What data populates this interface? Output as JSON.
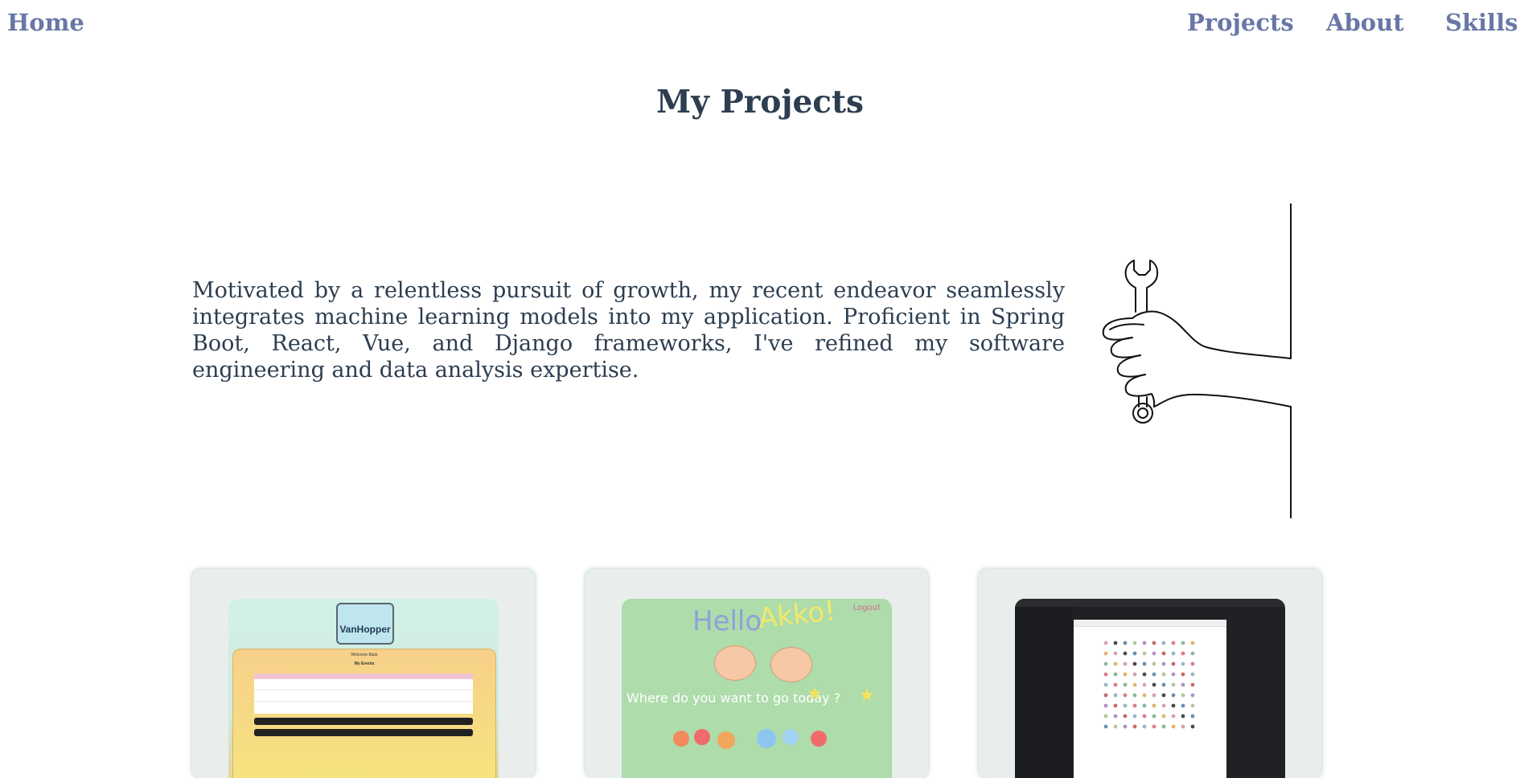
{
  "nav": {
    "home": "Home",
    "projects": "Projects",
    "about": "About",
    "skills": "Skills"
  },
  "page": {
    "title": "My Projects",
    "intro": "Motivated by a relentless pursuit of growth, my recent endeavor seamlessly integrates machine learning models into my application. Proficient in Spring Boot, React, Vue, and Django frameworks, I've refined my software engineering and data analysis expertise."
  },
  "illustration": {
    "icon": "hand-holding-wrench"
  },
  "projects": [
    {
      "thumbnail": {
        "logo": "VanHopper",
        "heading": "Welcome Back",
        "subheading": "My Events"
      }
    },
    {
      "thumbnail": {
        "hello": "Hello",
        "name": "Akko!",
        "logout": "Logout",
        "prompt": "Where do you want to go today ?"
      }
    },
    {
      "thumbnail": {
        "theme": "dark-editor-with-color-dot-grid"
      }
    }
  ],
  "colors": {
    "nav": "#6877a6",
    "text": "#2c3e50",
    "card_bg": "#e9eeec",
    "card_shadow": "#468c6e"
  }
}
